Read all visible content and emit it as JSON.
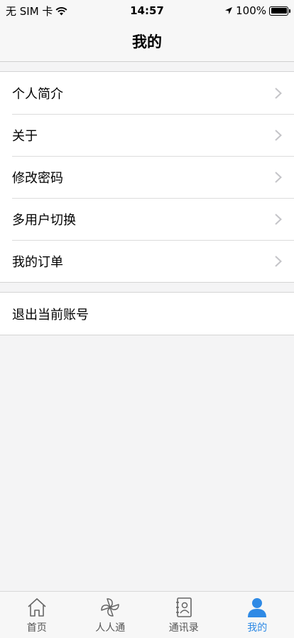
{
  "status_bar": {
    "carrier": "无 SIM 卡",
    "time": "14:57",
    "battery": "100%"
  },
  "header": {
    "title": "我的"
  },
  "menu": {
    "items": [
      {
        "label": "个人简介"
      },
      {
        "label": "关于"
      },
      {
        "label": "修改密码"
      },
      {
        "label": "多用户切换"
      },
      {
        "label": "我的订单"
      }
    ],
    "logout_label": "退出当前账号"
  },
  "tabbar": {
    "active_color": "#2f8ae5",
    "tabs": [
      {
        "label": "首页",
        "icon": "home-icon"
      },
      {
        "label": "人人通",
        "icon": "pinwheel-icon"
      },
      {
        "label": "通讯录",
        "icon": "contacts-icon"
      },
      {
        "label": "我的",
        "icon": "person-icon"
      }
    ]
  }
}
